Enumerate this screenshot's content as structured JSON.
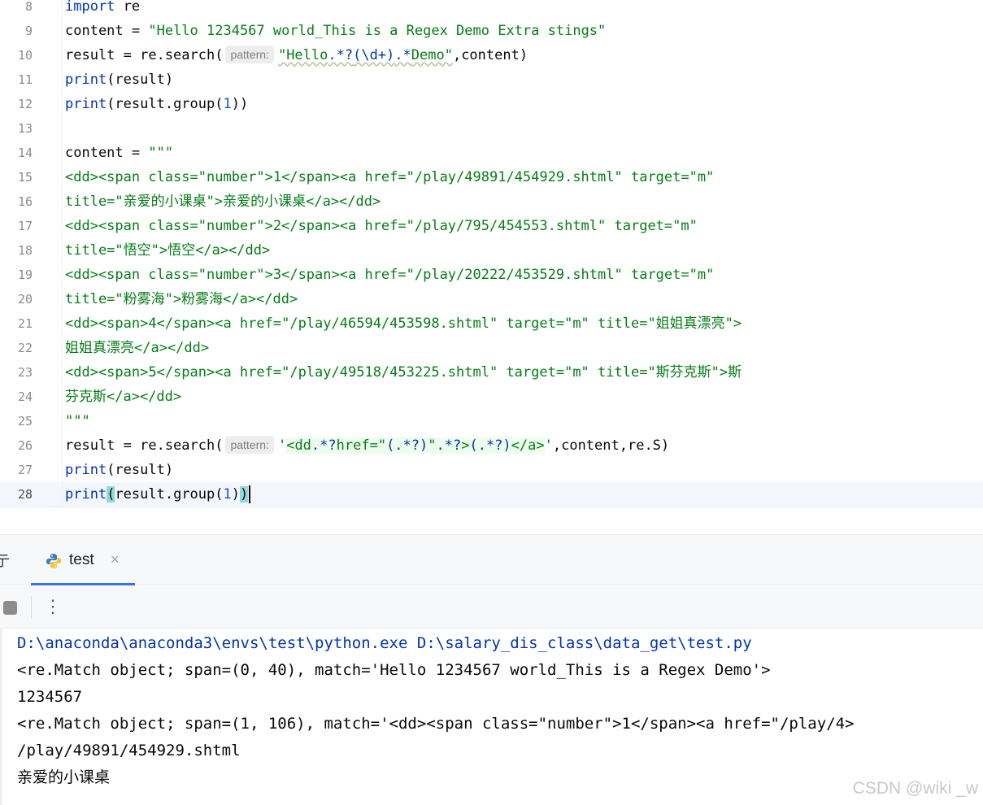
{
  "editor": {
    "param_hint": "pattern:",
    "line_numbers": [
      "8",
      "9",
      "10",
      "11",
      "12",
      "13",
      "14",
      "15",
      "16",
      "17",
      "18",
      "19",
      "20",
      "21",
      "22",
      "23",
      "24",
      "25",
      "26",
      "27",
      "28"
    ],
    "l8_kw": "import",
    "l8_rest": " re",
    "l9_a": "content = ",
    "l9_str": "\"Hello 1234567 world_This is a Regex Demo Extra stings\"",
    "l10_a": "result = re.search(",
    "l10_q1": "\"Hello",
    "l10_r1": ".*?",
    "l10_r2": "(\\d+)",
    "l10_r3": ".*",
    "l10_q2": "Demo\"",
    "l10_tail": ",content)",
    "l11_kw": "print",
    "l11_rest": "(result)",
    "l12_kw": "print",
    "l12_a": "(result.group(",
    "l12_num": "1",
    "l12_b": "))",
    "l14_a": "content = ",
    "l14_str": "\"\"\"",
    "l15": "<dd><span class=\"number\">1</span><a href=\"/play/49891/454929.shtml\" target=\"m\"",
    "l16": "title=\"亲爱的小课桌\">亲爱的小课桌</a></dd>",
    "l17": "<dd><span class=\"number\">2</span><a href=\"/play/795/454553.shtml\" target=\"m\"",
    "l18": "title=\"悟空\">悟空</a></dd>",
    "l19": "<dd><span class=\"number\">3</span><a href=\"/play/20222/453529.shtml\" target=\"m\"",
    "l20": "title=\"粉雾海\">粉雾海</a></dd>",
    "l21": "<dd><span>4</span><a href=\"/play/46594/453598.shtml\" target=\"m\" title=\"姐姐真漂亮\">",
    "l22": "姐姐真漂亮</a></dd>",
    "l23": "<dd><span>5</span><a href=\"/play/49518/453225.shtml\" target=\"m\" title=\"斯芬克斯\">斯",
    "l24": "芬克斯</a></dd>",
    "l25": "\"\"\"",
    "l26_a": "result = re.search(",
    "l26_q1": "'",
    "l26_s1": "<dd",
    "l26_r1": ".*?",
    "l26_s2": "href=\"",
    "l26_r2": "(.*?)",
    "l26_s3": "\"",
    "l26_r3": ".*?",
    "l26_s4": ">",
    "l26_r4": "(.*?)",
    "l26_s5": "</a>",
    "l26_q2": "'",
    "l26_tail": ",content,re.S)",
    "l27_kw": "print",
    "l27_rest": "(result)",
    "l28_kw": "print",
    "l28_a": "(",
    "l28_b": "result.group(",
    "l28_num": "1",
    "l28_c": ")",
    "l28_d": ")"
  },
  "run_panel": {
    "partial_label": "亍",
    "tab_title": "test",
    "tab_close": "×",
    "more_glyph": "⋮"
  },
  "console": {
    "lines": [
      "D:\\anaconda\\anaconda3\\envs\\test\\python.exe D:\\salary_dis_class\\data_get\\test.py",
      "<re.Match object; span=(0, 40), match='Hello 1234567 world_This is a Regex Demo'>",
      "1234567",
      "<re.Match object; span=(1, 106), match='<dd><span class=\"number\">1</span><a href=\"/play/4>",
      "/play/49891/454929.shtml",
      "亲爱的小课桌"
    ]
  },
  "watermark": "CSDN @wiki _w",
  "colors": {
    "keyword": "#0033b3",
    "string": "#067d17",
    "number": "#1750eb",
    "regex": "#0037a6",
    "active_line": "#f3f6fd",
    "tab_underline": "#3574f0"
  }
}
